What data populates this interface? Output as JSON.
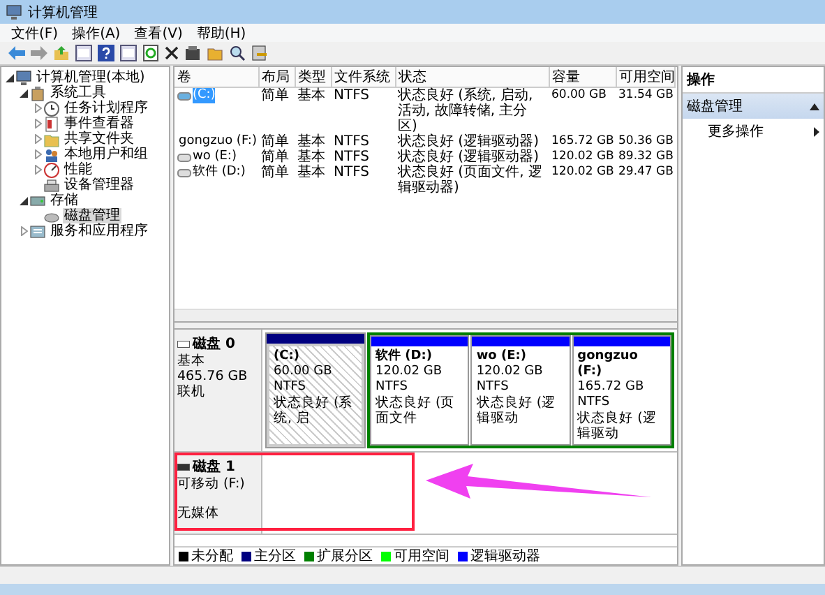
{
  "window": {
    "title": "计算机管理"
  },
  "menu": [
    "文件(F)",
    "操作(A)",
    "查看(V)",
    "帮助(H)"
  ],
  "tree": [
    {
      "label": "计算机管理(本地)",
      "kind": "computer",
      "expanded": true,
      "selected": false,
      "children": [
        {
          "label": "系统工具",
          "kind": "tools",
          "expanded": true,
          "selected": false,
          "children": [
            {
              "label": "任务计划程序",
              "kind": "clock",
              "expanded": false,
              "selected": false
            },
            {
              "label": "事件查看器",
              "kind": "log",
              "expanded": false,
              "selected": false
            },
            {
              "label": "共享文件夹",
              "kind": "folder",
              "expanded": false,
              "selected": false
            },
            {
              "label": "本地用户和组",
              "kind": "users",
              "expanded": false,
              "selected": false
            },
            {
              "label": "性能",
              "kind": "gauge",
              "expanded": false,
              "selected": false
            },
            {
              "label": "设备管理器",
              "kind": "device",
              "selected": false
            }
          ]
        },
        {
          "label": "存储",
          "kind": "storage",
          "expanded": true,
          "selected": false,
          "children": [
            {
              "label": "磁盘管理",
              "kind": "disk",
              "selected": true
            }
          ]
        },
        {
          "label": "服务和应用程序",
          "kind": "services",
          "expanded": false,
          "selected": false
        }
      ]
    }
  ],
  "table": {
    "columns": [
      "卷",
      "布局",
      "类型",
      "文件系统",
      "状态",
      "容量",
      "可用空间"
    ],
    "rows": [
      {
        "volume": "(C:)",
        "layout": "简单",
        "type": "基本",
        "fs": "NTFS",
        "status": "状态良好 (系统, 启动, 活动, 故障转储, 主分区)",
        "capacity": "60.00 GB",
        "free": "31.54 GB",
        "selected": true
      },
      {
        "volume": "gongzuo (F:)",
        "layout": "简单",
        "type": "基本",
        "fs": "NTFS",
        "status": "状态良好 (逻辑驱动器)",
        "capacity": "165.72 GB",
        "free": "50.36 GB",
        "selected": false
      },
      {
        "volume": "wo (E:)",
        "layout": "简单",
        "type": "基本",
        "fs": "NTFS",
        "status": "状态良好 (逻辑驱动器)",
        "capacity": "120.02 GB",
        "free": "89.32 GB",
        "selected": false
      },
      {
        "volume": "软件 (D:)",
        "layout": "简单",
        "type": "基本",
        "fs": "NTFS",
        "status": "状态良好 (页面文件, 逻辑驱动器)",
        "capacity": "120.02 GB",
        "free": "29.47 GB",
        "selected": false
      }
    ]
  },
  "disks": [
    {
      "name": "磁盘 0",
      "kind": "basic",
      "info": [
        "基本",
        "465.76 GB",
        "联机"
      ],
      "partitions": [
        {
          "kind": "primary",
          "selected": true,
          "label": "(C:)",
          "size": "60.00 GB NTFS",
          "status": "状态良好 (系统, 启"
        },
        {
          "kind": "extended",
          "partitions": [
            {
              "kind": "logical",
              "selected": false,
              "label": "软件 (D:)",
              "size": "120.02 GB NTFS",
              "status": "状态良好 (页面文件"
            },
            {
              "kind": "logical",
              "selected": false,
              "label": "wo (E:)",
              "size": "120.02 GB NTFS",
              "status": "状态良好 (逻辑驱动"
            },
            {
              "kind": "logical",
              "selected": false,
              "label": "gongzuo (F:)",
              "size": "165.72 GB NTFS",
              "status": "状态良好 (逻辑驱动"
            }
          ]
        }
      ]
    },
    {
      "name": "磁盘 1",
      "kind": "removable",
      "info": [
        "可移动 (F:)",
        "无媒体"
      ]
    }
  ],
  "legend": [
    {
      "label": "未分配",
      "color": "#000000"
    },
    {
      "label": "主分区",
      "color": "#000080"
    },
    {
      "label": "扩展分区",
      "color": "#008000"
    },
    {
      "label": "可用空间",
      "color": "#00ff00"
    },
    {
      "label": "逻辑驱动器",
      "color": "#0000ff"
    }
  ],
  "actions": {
    "title": "操作",
    "sections": [
      {
        "label": "磁盘管理",
        "expanded": true,
        "items": [
          "更多操作"
        ]
      }
    ]
  }
}
